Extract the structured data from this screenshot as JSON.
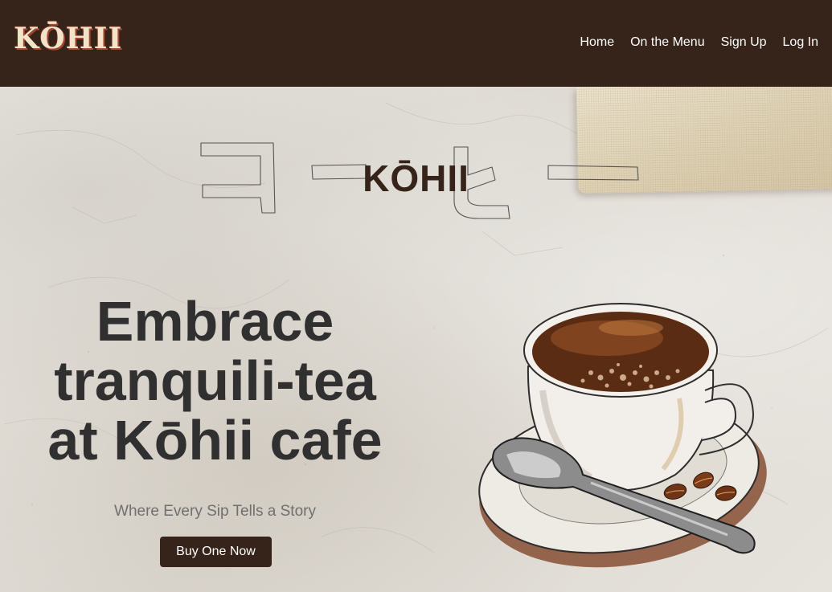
{
  "header": {
    "logo": "KŌHII",
    "nav": [
      {
        "label": "Home"
      },
      {
        "label": "On the Menu"
      },
      {
        "label": "Sign Up"
      },
      {
        "label": "Log In"
      }
    ]
  },
  "hero": {
    "brand": "KŌHII",
    "headline_lines": [
      "Embrace",
      "tranquili-tea",
      "at Kōhii cafe"
    ],
    "tagline": "Where Every Sip Tells a Story",
    "cta_label": "Buy One Now"
  },
  "colors": {
    "brand_dark": "#36231a",
    "headline": "#303030",
    "tagline": "#707070",
    "logo_cream": "#f2e3c9"
  },
  "icons": {
    "hero_image": "coffee-cup-illustration",
    "background_text": "katakana-outline"
  }
}
